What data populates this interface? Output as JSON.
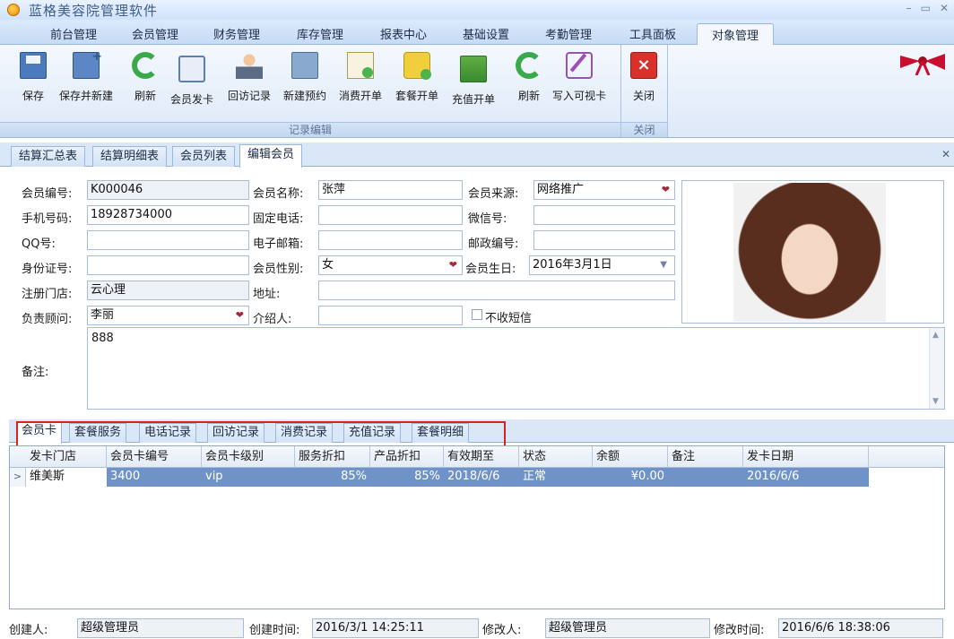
{
  "app": {
    "title": "蓝格美容院管理软件"
  },
  "window_controls": {
    "minimize": "–",
    "maximize": "▭",
    "close": "✕"
  },
  "menu": {
    "tabs": [
      "前台管理",
      "会员管理",
      "财务管理",
      "库存管理",
      "报表中心",
      "基础设置",
      "考勤管理",
      "工具面板",
      "对象管理"
    ],
    "active": "对象管理"
  },
  "ribbon": {
    "group_edit_label": "记录编辑",
    "group_close_label": "关闭",
    "buttons": [
      {
        "label": "保存",
        "icon": "save-icon"
      },
      {
        "label": "保存并新建",
        "icon": "save-new-icon"
      },
      {
        "label": "刷新",
        "icon": "refresh-icon"
      },
      {
        "label": "会员发卡",
        "icon": "member-card-icon"
      },
      {
        "label": "回访记录",
        "icon": "person-icon"
      },
      {
        "label": "新建预约",
        "icon": "appointment-icon"
      },
      {
        "label": "消费开单",
        "icon": "consume-order-icon"
      },
      {
        "label": "套餐开单",
        "icon": "package-order-icon"
      },
      {
        "label": "充值开单",
        "icon": "recharge-icon"
      },
      {
        "label": "刷新",
        "icon": "refresh-icon"
      },
      {
        "label": "写入可视卡",
        "icon": "write-card-icon"
      }
    ],
    "close_button": {
      "label": "关闭",
      "icon": "close-icon"
    }
  },
  "doc_tabs": [
    "结算汇总表",
    "结算明细表",
    "会员列表",
    "编辑会员"
  ],
  "form": {
    "member_no_label": "会员编号:",
    "member_no": "K000046",
    "member_name_label": "会员名称:",
    "member_name": "张萍",
    "source_label": "会员来源:",
    "source": "网络推广",
    "phone_label": "手机号码:",
    "phone": "18928734000",
    "tel_label": "固定电话:",
    "tel": "",
    "wechat_label": "微信号:",
    "wechat": "",
    "qq_label": "QQ号:",
    "qq": "",
    "email_label": "电子邮箱:",
    "email": "",
    "postcode_label": "邮政编号:",
    "postcode": "",
    "idcard_label": "身份证号:",
    "idcard": "",
    "gender_label": "会员性别:",
    "gender": "女",
    "birthday_label": "会员生日:",
    "birthday": "2016年3月1日",
    "store_label": "注册门店:",
    "store": "云心理",
    "address_label": "地址:",
    "address": "",
    "advisor_label": "负责顾问:",
    "advisor": "李丽",
    "referrer_label": "介绍人:",
    "referrer": "",
    "no_sms_label": "不收短信",
    "notes_label": "备注:",
    "notes": "888"
  },
  "sub_tabs": [
    "会员卡",
    "套餐服务",
    "电话记录",
    "回访记录",
    "消费记录",
    "充值记录",
    "套餐明细"
  ],
  "grid": {
    "columns": [
      "发卡门店",
      "会员卡编号",
      "会员卡级别",
      "服务折扣",
      "产品折扣",
      "有效期至",
      "状态",
      "余额",
      "备注",
      "发卡日期"
    ],
    "rows": [
      [
        "维美斯",
        "3400",
        "vip",
        "85%",
        "85%",
        "2018/6/6",
        "正常",
        "¥0.00",
        "",
        "2016/6/6"
      ]
    ]
  },
  "footer": {
    "creator_label": "创建人:",
    "creator": "超级管理员",
    "created_label": "创建时间:",
    "created": "2016/3/1 14:25:11",
    "modifier_label": "修改人:",
    "modifier": "超级管理员",
    "modified_label": "修改时间:",
    "modified": "2016/6/6 18:38:06"
  },
  "colors": {
    "accent": "#6f93c9",
    "highlight_box": "#e0201d"
  }
}
